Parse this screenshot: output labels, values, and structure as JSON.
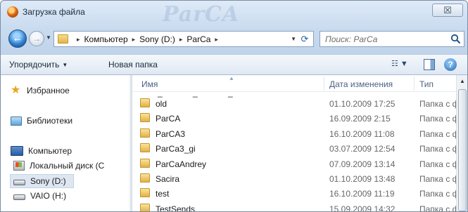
{
  "window": {
    "title": "Загрузка файла",
    "watermark": "ParCA",
    "close_glyph": "☒"
  },
  "nav_buttons": {
    "back_glyph": "←",
    "forward_glyph": "→",
    "history_glyph": "▼"
  },
  "address": {
    "crumbs": [
      "Компьютер",
      "Sony (D:)",
      "ParCa"
    ],
    "separator": "▸",
    "dropdown_glyph": "▼",
    "refresh_glyph": "⟳"
  },
  "search": {
    "placeholder": "Поиск: ParCa"
  },
  "toolbar": {
    "organize_label": "Упорядочить",
    "organize_arrow": "▼",
    "new_folder_label": "Новая папка",
    "view_glyph": "☷ ▼",
    "help_glyph": "?"
  },
  "nav": {
    "favorites": "Избранное",
    "libraries": "Библиотеки",
    "computer": "Компьютер",
    "local_disk": "Локальный диск (C",
    "sony": "Sony (D:)",
    "vaio": "VAIO (H:)",
    "star_glyph": "★"
  },
  "columns": {
    "name": "Имя",
    "date": "Дата изменения",
    "type": "Тип",
    "sort_glyph": "▲"
  },
  "partial_top_row": "_ _ _",
  "files": [
    {
      "name": "old",
      "date": "01.10.2009 17:25",
      "type": "Папка с ф"
    },
    {
      "name": "ParCA",
      "date": "16.09.2009 2:15",
      "type": "Папка с ф"
    },
    {
      "name": "ParCA3",
      "date": "16.10.2009 11:08",
      "type": "Папка с ф"
    },
    {
      "name": "ParCa3_gi",
      "date": "03.07.2009 12:54",
      "type": "Папка с ф"
    },
    {
      "name": "ParCaAndrey",
      "date": "07.09.2009 13:14",
      "type": "Папка с ф"
    },
    {
      "name": "Sacira",
      "date": "01.10.2009 13:48",
      "type": "Папка с ф"
    },
    {
      "name": "test",
      "date": "16.10.2009 11:19",
      "type": "Папка с ф"
    },
    {
      "name": "TestSends",
      "date": "15.09.2009 14:32",
      "type": "Папка с ф"
    }
  ],
  "scrollbar": {
    "up_glyph": "▲"
  }
}
